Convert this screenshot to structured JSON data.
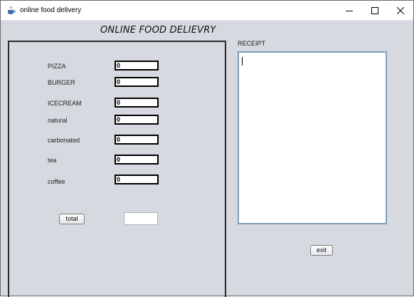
{
  "window": {
    "title": "online food delivery",
    "icons": {
      "app": "java-cup-icon",
      "minimize": "minimize-icon",
      "maximize": "maximize-icon",
      "close": "close-icon"
    }
  },
  "heading": "ONLINE FOOD DELIEVRY",
  "items": [
    {
      "label": "PIZZA",
      "value": "0"
    },
    {
      "label": "BURGER",
      "value": "0"
    },
    {
      "label": "ICECREAM",
      "value": "0"
    },
    {
      "label": "natural",
      "value": "0"
    },
    {
      "label": "carbonated",
      "value": "0"
    },
    {
      "label": "tea",
      "value": "0"
    },
    {
      "label": "coffee",
      "value": "0"
    }
  ],
  "total": {
    "button_label": "total",
    "value": ""
  },
  "receipt": {
    "label": "RECEIPT",
    "content": ""
  },
  "exit_label": "exit",
  "colors": {
    "panel_bg": "#d6d9df",
    "receipt_border": "#7f9db9"
  }
}
